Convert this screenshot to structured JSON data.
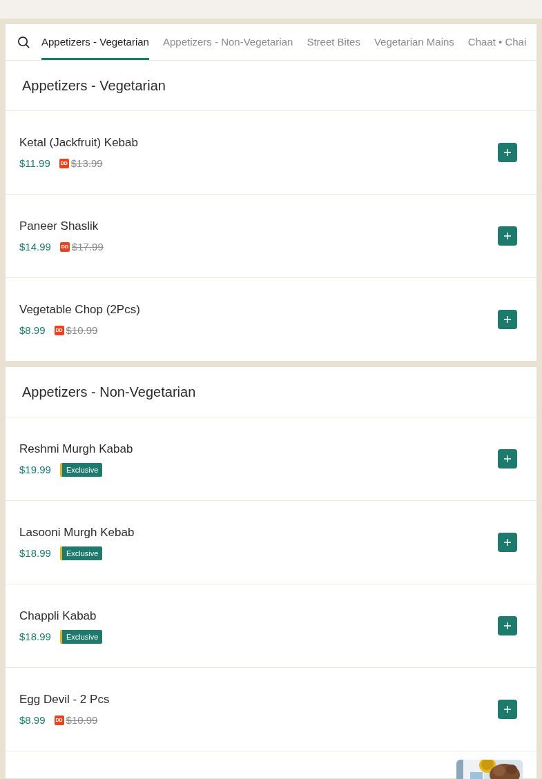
{
  "tabs": [
    {
      "label": "Appetizers - Vegetarian",
      "selected": true
    },
    {
      "label": "Appetizers - Non-Vegetarian",
      "selected": false
    },
    {
      "label": "Street Bites",
      "selected": false
    },
    {
      "label": "Vegetarian Mains",
      "selected": false
    },
    {
      "label": "Chaat • Chai",
      "selected": false
    }
  ],
  "sections": [
    {
      "title": "Appetizers - Vegetarian",
      "items": [
        {
          "name": "Ketal (Jackfruit) Kebab",
          "price": "$11.99",
          "badge": {
            "kind": "dd",
            "label": "DD"
          },
          "original_price": "$13.99"
        },
        {
          "name": "Paneer Shaslik",
          "price": "$14.99",
          "badge": {
            "kind": "dd",
            "label": "DD"
          },
          "original_price": "$17.99"
        },
        {
          "name": "Vegetable Chop (2Pcs)",
          "price": "$8.99",
          "badge": {
            "kind": "dd",
            "label": "DD"
          },
          "original_price": "$10.99"
        }
      ]
    },
    {
      "title": "Appetizers - Non-Vegetarian",
      "items": [
        {
          "name": "Reshmi Murgh Kabab",
          "price": "$19.99",
          "badge": {
            "kind": "exclusive",
            "label": "Exclusive"
          }
        },
        {
          "name": "Lasooni Murgh Kebab",
          "price": "$18.99",
          "badge": {
            "kind": "exclusive",
            "label": "Exclusive"
          }
        },
        {
          "name": "Chappli Kabab",
          "price": "$18.99",
          "badge": {
            "kind": "exclusive",
            "label": "Exclusive"
          }
        },
        {
          "name": "Egg Devil - 2 Pcs",
          "price": "$8.99",
          "badge": {
            "kind": "dd",
            "label": "DD"
          },
          "original_price": "$10.99"
        },
        {
          "kind": "picture"
        }
      ]
    }
  ]
}
